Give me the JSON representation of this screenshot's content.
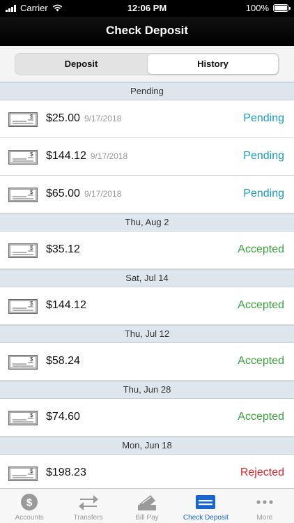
{
  "status_bar": {
    "carrier": "Carrier",
    "time": "12:06 PM",
    "battery": "100%"
  },
  "nav": {
    "title": "Check Deposit"
  },
  "segment": {
    "deposit_label": "Deposit",
    "history_label": "History",
    "selected": "History"
  },
  "colors": {
    "pending": "#1a9bc2",
    "accepted": "#3aa33c",
    "rejected": "#e0242c",
    "active_tab": "#1a66d0"
  },
  "sections": [
    {
      "header": "Pending",
      "rows": [
        {
          "amount": "$25.00",
          "date": "9/17/2018",
          "status": "Pending",
          "status_type": "pending"
        },
        {
          "amount": "$144.12",
          "date": "9/17/2018",
          "status": "Pending",
          "status_type": "pending"
        },
        {
          "amount": "$65.00",
          "date": "9/17/2018",
          "status": "Pending",
          "status_type": "pending"
        }
      ]
    },
    {
      "header": "Thu, Aug 2",
      "rows": [
        {
          "amount": "$35.12",
          "date": "",
          "status": "Accepted",
          "status_type": "accepted"
        }
      ]
    },
    {
      "header": "Sat, Jul 14",
      "rows": [
        {
          "amount": "$144.12",
          "date": "",
          "status": "Accepted",
          "status_type": "accepted"
        }
      ]
    },
    {
      "header": "Thu, Jul 12",
      "rows": [
        {
          "amount": "$58.24",
          "date": "",
          "status": "Accepted",
          "status_type": "accepted"
        }
      ]
    },
    {
      "header": "Thu, Jun 28",
      "rows": [
        {
          "amount": "$74.60",
          "date": "",
          "status": "Accepted",
          "status_type": "accepted"
        }
      ]
    },
    {
      "header": "Mon, Jun 18",
      "rows": [
        {
          "amount": "$198.23",
          "date": "",
          "status": "Rejected",
          "status_type": "rejected"
        }
      ]
    }
  ],
  "tabs": [
    {
      "label": "Accounts",
      "icon": "dollar-circle-icon",
      "active": false
    },
    {
      "label": "Transfers",
      "icon": "transfer-arrows-icon",
      "active": false
    },
    {
      "label": "Bill Pay",
      "icon": "bill-pay-icon",
      "active": false
    },
    {
      "label": "Check Deposit",
      "icon": "check-deposit-icon",
      "active": true
    },
    {
      "label": "More",
      "icon": "more-dots-icon",
      "active": false
    }
  ]
}
